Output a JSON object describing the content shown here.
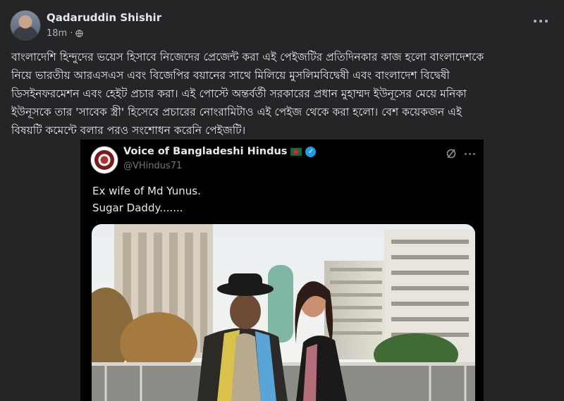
{
  "post": {
    "author_name": "Qadaruddin Shishir",
    "time": "18m",
    "privacy_icon": "globe-icon",
    "more_icon": "more-horizontal-icon",
    "body_lines": [
      "বাংলাদেশি হিন্দুদের ভয়েস হিসাবে নিজেদের প্রেজেন্ট করা এই পেইজটির প্রতিদিনকার কাজ হলো বাংলাদেশকে",
      "নিয়ে ভারতীয় আরএসএস এবং বিজেপির বয়ানের সাথে মিলিয়ে মুসলিমবিদ্বেষী এবং বাংলাদেশ বিদ্বেষী",
      "ডিসইনফরমেশন এবং হেইট প্রচার করা। এই পোস্টে অন্তর্বর্তী সরকারের প্রধান মুহাম্মদ ইউনূসের মেয়ে মনিকা",
      "ইউনূসকে তার 'সাবেক স্ত্রী' হিসেবে প্রচারের নোংরামিটাও এই পেইজ থেকে করা হলো। বেশ কয়েকজন এই",
      "বিষয়টি কমেন্টে বলার পরও সংশোধন করেনি পেইজটি।"
    ]
  },
  "embedded_tweet": {
    "name": "Voice of Bangladeshi Hindus",
    "flag_icon": "bangladesh-flag-icon",
    "verified_icon": "verified-badge-icon",
    "handle": "@VHindus71",
    "grok_icon": "grok-icon",
    "more_icon": "more-horizontal-icon",
    "text_lines": [
      "Ex wife of Md Yunus.",
      "Sugar Daddy......."
    ],
    "photo_icon": "photo-image"
  },
  "colors": {
    "background": "#242526",
    "text_primary": "#e4e6eb",
    "text_secondary": "#b0b3b8",
    "tweet_background": "#000000",
    "verified_blue": "#1d9bf0"
  }
}
